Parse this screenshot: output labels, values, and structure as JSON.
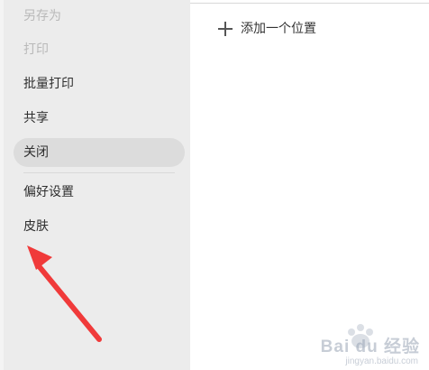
{
  "sidebar": {
    "items": [
      {
        "label": "另存为",
        "state": "disabled"
      },
      {
        "label": "打印",
        "state": "disabled"
      },
      {
        "label": "批量打印",
        "state": "enabled"
      },
      {
        "label": "共享",
        "state": "enabled"
      },
      {
        "label": "关闭",
        "state": "selected"
      },
      {
        "label": "偏好设置",
        "state": "enabled"
      },
      {
        "label": "皮肤",
        "state": "enabled"
      }
    ]
  },
  "main": {
    "add_location_label": "添加一个位置",
    "add_location_icon": "plus-icon"
  },
  "annotation": {
    "arrow_color": "#f03a3a",
    "arrow_icon": "red-arrow-icon"
  },
  "watermark": {
    "text": "Bai du 经验",
    "sub": "jingyan.baidu.com"
  },
  "colors": {
    "sidebar_bg": "#ececec",
    "selected_bg": "#dcdcdc",
    "disabled_text": "#b9b9b9",
    "text": "#2f2f2f"
  }
}
